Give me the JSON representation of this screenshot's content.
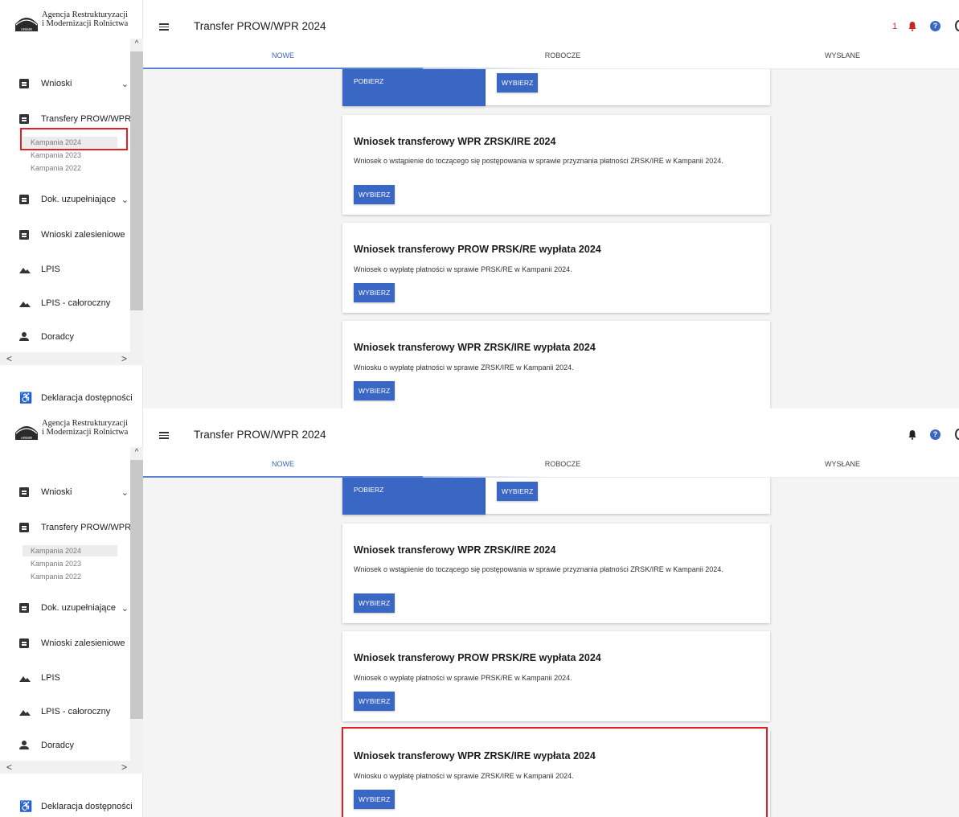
{
  "logo": {
    "line1": "Agencja Restrukturyzacji",
    "line2": "i Modernizacji Rolnictwa",
    "mark_text": "ARiMR"
  },
  "sidebar": {
    "items": [
      {
        "label": "Wnioski",
        "icon": "clipboard-icon",
        "chevron": "⌄"
      },
      {
        "label": "Transfery PROW/WPR",
        "icon": "clipboard-icon"
      },
      {
        "label": "Dok. uzupełniające",
        "icon": "clipboard-icon",
        "chevron": "⌄"
      },
      {
        "label": "Wnioski zalesieniowe",
        "icon": "clipboard-icon"
      },
      {
        "label": "LPIS",
        "icon": "mountain-icon"
      },
      {
        "label": "LPIS - całoroczny",
        "icon": "mountain-icon"
      },
      {
        "label": "Doradcy",
        "icon": "person-icon"
      }
    ],
    "sub_items": [
      "Kampania 2024",
      "Kampania 2023",
      "Kampania 2022"
    ],
    "accessibility": "Deklaracja dostępności"
  },
  "header": {
    "title": "Transfer PROW/WPR 2024",
    "notif_count_top": "1",
    "notif_count_bottom": "",
    "help": "?"
  },
  "tabs": [
    "NOWE",
    "ROBOCZE",
    "WYSŁANE"
  ],
  "colors": {
    "accent": "#3a66c4",
    "highlight": "#e31e24",
    "alert": "#c62828"
  },
  "top_partial": {
    "left_button": "POBIERZ",
    "right_button": "WYBIERZ"
  },
  "cards": [
    {
      "title": "Wniosek transferowy WPR ZRSK/IRE 2024",
      "desc": "Wniosek o wstąpienie do toczącego się postępowania w sprawie przyznania płatności ZRSK/IRE w Kampanii 2024.",
      "button": "WYBIERZ"
    },
    {
      "title": "Wniosek transferowy PROW PRSK/RE wypłata 2024",
      "desc": "Wniosek o wypłatę płatności w sprawie PRSK/RE w Kampanii 2024.",
      "button": "WYBIERZ"
    },
    {
      "title": "Wniosek transferowy WPR ZRSK/IRE wypłata 2024",
      "desc": "Wniosku o wypłatę płatności w sprawie ZRSK/IRE w Kampanii 2024.",
      "button": "WYBIERZ"
    }
  ]
}
